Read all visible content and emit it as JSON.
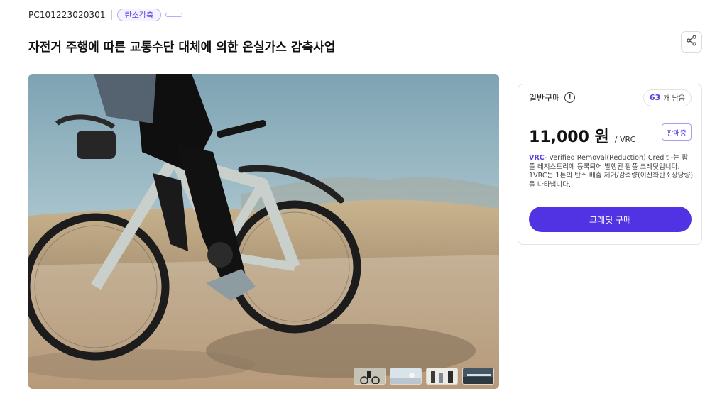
{
  "product": {
    "code": "PC101223020301",
    "tag": "탄소감축",
    "title": "자전거 주행에 따른 교통수단 대체에 의한 온실가스 감축사업"
  },
  "icons": {
    "share": "share-icon",
    "info": "info-icon"
  },
  "purchase": {
    "type_label": "일반구매",
    "info_symbol": "!",
    "stock_count": "63",
    "stock_suffix": "개 남음",
    "price": "11,000 원",
    "price_unit": "/ VRC",
    "status_badge": "판매중",
    "desc_vrc": "VRC",
    "desc_text": "- Verified Removal(Reduction) Credit -는 팝플 레지스트리에 등록되어 발행된 팝플 크레딧입니다. 1VRC는 1톤의 탄소 배출 제거/감축량(이산화탄소상당량)을 나타냅니다.",
    "buy_button": "크레딧 구매"
  },
  "gallery": {
    "main_image": "cyclist riding a gravel bike on a dirt road",
    "thumbnails": [
      "cyclist-thumb",
      "landscape-thumb",
      "bikes-thumb",
      "building-thumb"
    ]
  },
  "colors": {
    "accent": "#5133e3",
    "accent_text": "#5b3fe0",
    "tag_border": "#b7aef0"
  }
}
